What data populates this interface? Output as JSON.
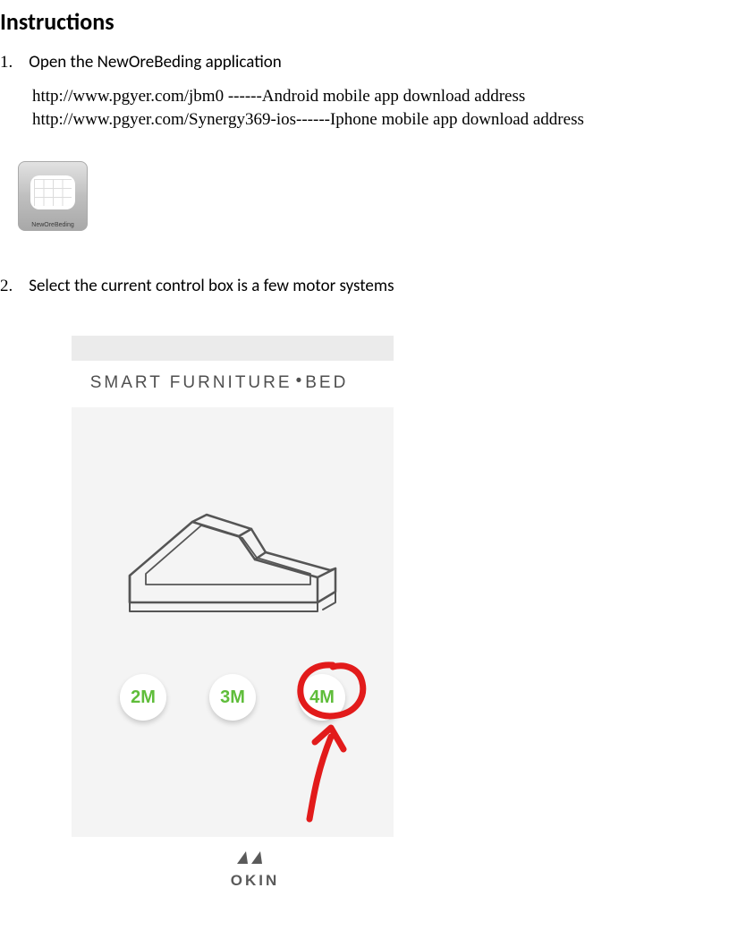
{
  "title": "Instructions",
  "steps": [
    {
      "number": "1.",
      "text": "Open the NewOreBeding application"
    },
    {
      "number": "2.",
      "text": "Select the current control box is a few motor systems"
    }
  ],
  "downloads": {
    "android_url": "http://www.pgyer.com/jbm0",
    "android_label": "  ------Android mobile app download address",
    "iphone_url": "http://www.pgyer.com/Synergy369-ios",
    "iphone_label": "------Iphone mobile app download address"
  },
  "app_icon": {
    "label": "NewOreBeding"
  },
  "screenshot": {
    "header_left": "SMART FURNITURE",
    "header_right": "BED",
    "motor_buttons": [
      "2M",
      "3M",
      "4M"
    ],
    "highlighted_button_index": 2
  },
  "logo": {
    "text": "OKIN"
  }
}
